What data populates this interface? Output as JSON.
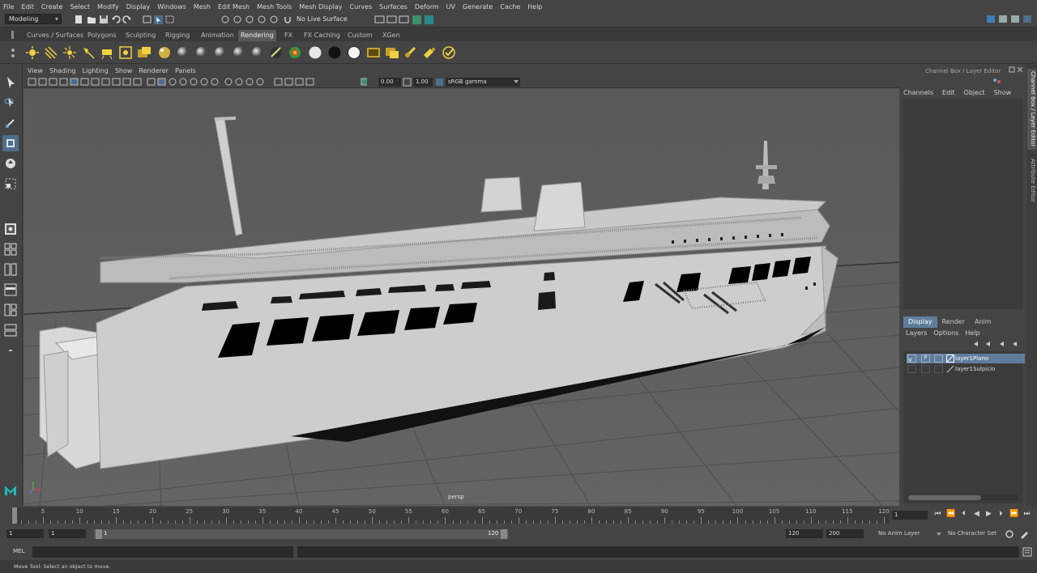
{
  "menubar": {
    "items": [
      "File",
      "Edit",
      "Create",
      "Select",
      "Modify",
      "Display",
      "Windows",
      "Mesh",
      "Edit Mesh",
      "Mesh Tools",
      "Mesh Display",
      "Curves",
      "Surfaces",
      "Deform",
      "UV",
      "Generate",
      "Cache",
      "Help"
    ]
  },
  "statusline": {
    "workspace": "Modeling",
    "live_surface": "No Live Surface"
  },
  "shelf": {
    "tabs": [
      "Curves / Surfaces",
      "Polygons",
      "Sculpting",
      "Rigging",
      "Animation",
      "Rendering",
      "FX",
      "FX Caching",
      "Custom",
      "XGen"
    ],
    "active_tab": "Rendering",
    "icons": [
      "ambient-light-icon",
      "directional-light-icon",
      "point-light-icon",
      "spot-light-icon",
      "area-light-icon",
      "volume-light-icon",
      "render-settings-icon",
      "blinn-sphere-icon",
      "lambert-sphere-icon",
      "phong-sphere-icon",
      "surface-shader-icon",
      "anisotropic-shader-icon",
      "ramp-shader-icon",
      "toon-shader-icon",
      "white-sphere-icon",
      "black-sphere-icon",
      "white-sphere-icon",
      "render-view-icon",
      "ipr-render-icon",
      "render-sequence-icon",
      "hypershade-icon",
      "render-setup-icon"
    ]
  },
  "viewport": {
    "menu": [
      "View",
      "Shading",
      "Lighting",
      "Show",
      "Renderer",
      "Panels"
    ],
    "exposure": "0.00",
    "gamma": "1.00",
    "color_space": "sRGB gamma",
    "camera": "persp"
  },
  "channel_box": {
    "title": "Channel Box / Layer Editor",
    "menu": [
      "Channels",
      "Edit",
      "Object",
      "Show"
    ]
  },
  "layer_editor": {
    "tabs": [
      "Display",
      "Render",
      "Anim"
    ],
    "active_tab": "Display",
    "menu": [
      "Layers",
      "Options",
      "Help"
    ],
    "layers": [
      {
        "name": "layer1Plano",
        "selected": true,
        "visibility": "V",
        "playback": "P"
      },
      {
        "name": "layer1Sulpicio",
        "selected": false,
        "visibility": "",
        "playback": ""
      }
    ]
  },
  "side_tabs": [
    "Channel Box / Layer Editor",
    "Attribute Editor"
  ],
  "timeslider": {
    "ticks": [
      "1",
      "5",
      "10",
      "15",
      "20",
      "25",
      "30",
      "35",
      "40",
      "45",
      "50",
      "55",
      "60",
      "65",
      "70",
      "75",
      "80",
      "85",
      "90",
      "95",
      "100",
      "105",
      "110",
      "115",
      "120"
    ],
    "current_frame": "1"
  },
  "rangeslider": {
    "start": "1",
    "start_inner": "1",
    "range_start": "1",
    "range_end": "120",
    "end": "120",
    "end_outer": "200",
    "anim_layer": "No Anim Layer",
    "character_set": "No Character Set"
  },
  "cmdline": {
    "label": "MEL"
  },
  "helpline": {
    "text": "Move Tool: Select an object to move."
  },
  "colors": {
    "accent": "#5e7d9c",
    "viewport_bg": "#5b5b5b",
    "panel_bg": "#444444"
  }
}
